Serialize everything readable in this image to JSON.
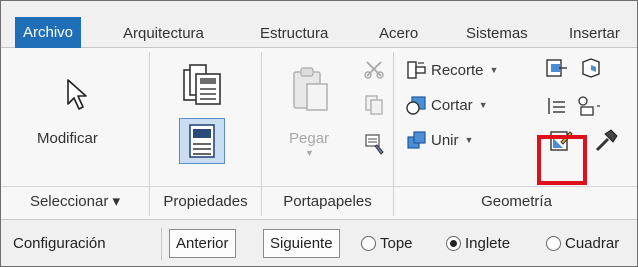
{
  "tabs": [
    {
      "label": "Archivo",
      "active": true
    },
    {
      "label": "Arquitectura",
      "active": false
    },
    {
      "label": "Estructura",
      "active": false
    },
    {
      "label": "Acero",
      "active": false
    },
    {
      "label": "Sistemas",
      "active": false
    },
    {
      "label": "Insertar",
      "active": false
    }
  ],
  "ribbon": {
    "select_panel": {
      "title": "Seleccionar ▾",
      "modify_label": "Modificar"
    },
    "properties_panel": {
      "title": "Propiedades"
    },
    "clipboard_panel": {
      "title": "Portapapeles",
      "paste_label": "Pegar"
    },
    "geometry_panel": {
      "title": "Geometría",
      "cope_label": "Recorte",
      "cut_label": "Cortar",
      "join_label": "Unir"
    }
  },
  "options_bar": {
    "configuration_label": "Configuración",
    "previous_label": "Anterior",
    "next_label": "Siguiente",
    "radios": [
      {
        "label": "Tope",
        "selected": false
      },
      {
        "label": "Inglete",
        "selected": true
      },
      {
        "label": "Cuadrar",
        "selected": false
      }
    ]
  },
  "colors": {
    "active_tab": "#1f6fb8",
    "highlight": "#e0101a"
  }
}
